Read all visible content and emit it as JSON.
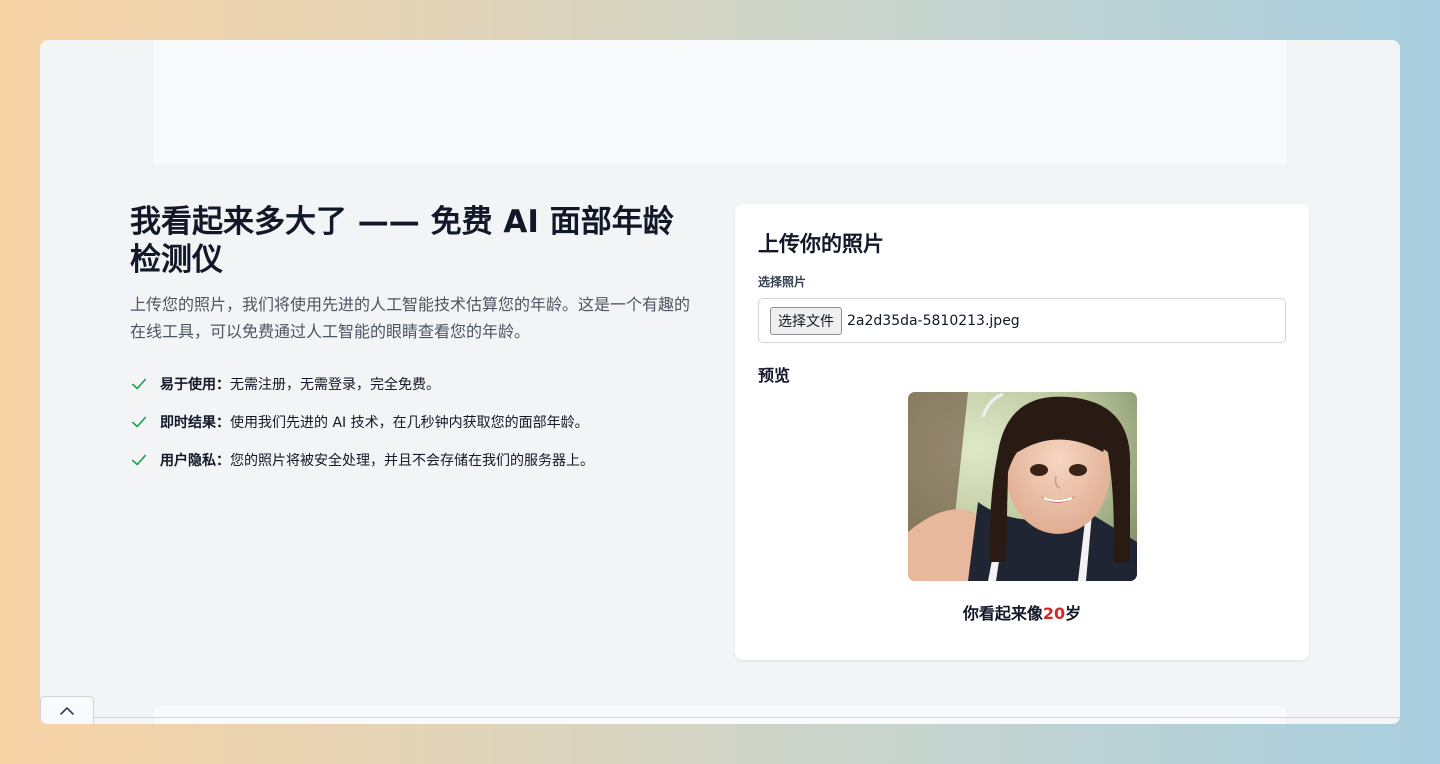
{
  "hero": {
    "title": "我看起来多大了 —— 免费 AI 面部年龄检测仪",
    "description": "上传您的照片，我们将使用先进的人工智能技术估算您的年龄。这是一个有趣的在线工具，可以免费通过人工智能的眼睛查看您的年龄。"
  },
  "features": [
    {
      "title": "易于使用：",
      "text": "无需注册，无需登录，完全免费。"
    },
    {
      "title": "即时结果：",
      "text": "使用我们先进的 AI 技术，在几秒钟内获取您的面部年龄。"
    },
    {
      "title": "用户隐私：",
      "text": "您的照片将被安全处理，并且不会存储在我们的服务器上。"
    }
  ],
  "upload": {
    "title": "上传你的照片",
    "field_label": "选择照片",
    "button_label": "选择文件",
    "file_name": "2a2d35da-5810213.jpeg",
    "preview_label": "预览",
    "result_prefix": "你看起来像",
    "age": "20",
    "result_suffix": "岁"
  },
  "colors": {
    "accent_check": "#16a34a",
    "age_highlight": "#dc2626"
  },
  "icons": {
    "feature": "check-icon",
    "collapse": "chevron-up-icon"
  }
}
